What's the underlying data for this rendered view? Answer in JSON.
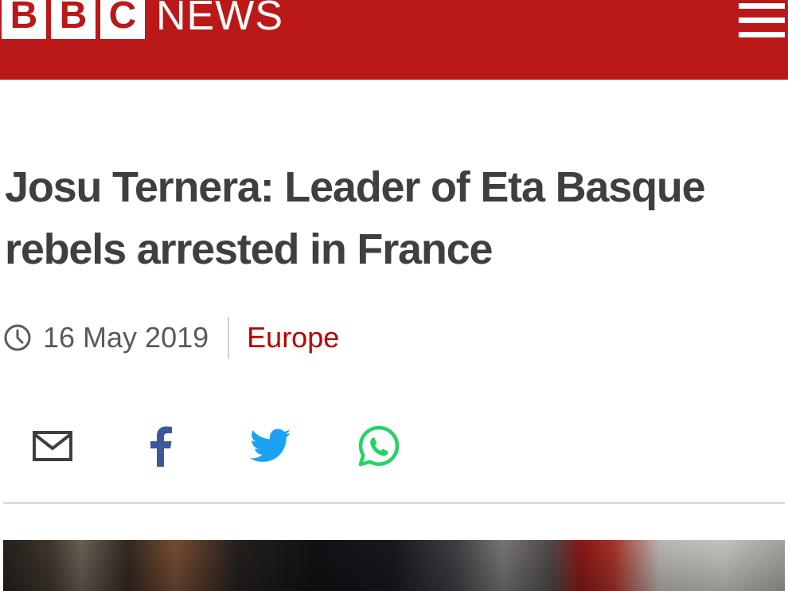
{
  "header": {
    "logo_letters": [
      "B",
      "B",
      "C"
    ],
    "logo_news": "NEWS",
    "menu_icon": "hamburger-menu-icon",
    "brand_color": "#bb1919"
  },
  "article": {
    "headline": "Josu Ternera: Leader of Eta Basque rebels arrested in France",
    "date": "16 May 2019",
    "topic": "Europe",
    "topic_color": "#b80000"
  },
  "share": {
    "buttons": [
      {
        "name": "email-icon"
      },
      {
        "name": "facebook-icon"
      },
      {
        "name": "twitter-icon"
      },
      {
        "name": "whatsapp-icon"
      }
    ]
  }
}
